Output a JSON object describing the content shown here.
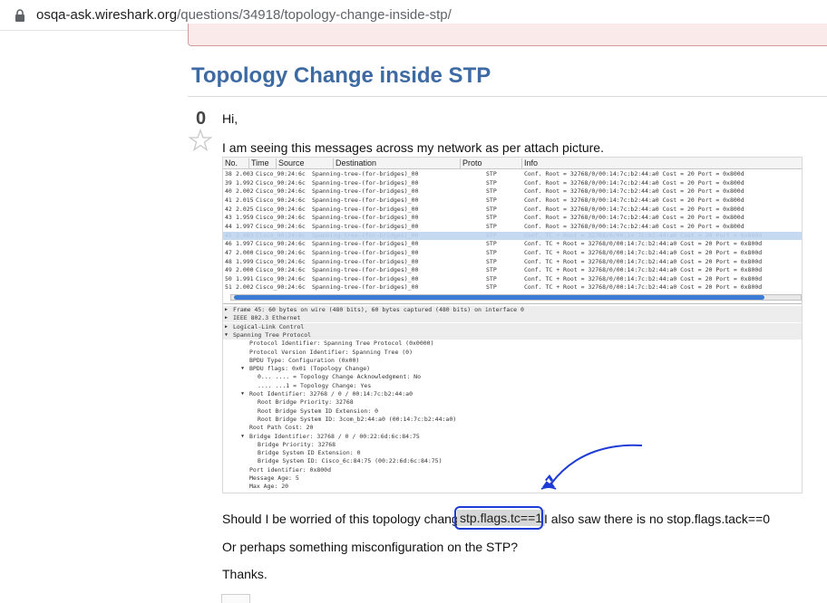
{
  "browser": {
    "url_host": "osqa-ask.wireshark.org",
    "url_path": "/questions/34918/topology-change-inside-stp/"
  },
  "question": {
    "title": "Topology Change inside STP",
    "votes": "0"
  },
  "body": {
    "greeting": "Hi,",
    "intro": "I am seeing this messages across my network as per attach picture.",
    "worry_prefix": "Should I be worried of this topology changes",
    "filter_code": "stp.flags.tc==1",
    "worry_suffix": "I also saw there is no stop.flags.tack==0",
    "misconfig": "Or perhaps something misconfiguration on the STP?",
    "thanks": "Thanks."
  },
  "wireshark": {
    "columns": [
      "No.",
      "Time",
      "Source",
      "Destination",
      "Proto",
      "Info"
    ],
    "rows": [
      {
        "no": "38",
        "time": "2.003",
        "src": "Cisco_90:24:6c",
        "dst": "Spanning-tree-(for-bridges)_00",
        "proto": "STP",
        "info": "Conf. Root = 32768/0/00:14:7c:b2:44:a0   Cost = 20   Port = 0x800d"
      },
      {
        "no": "39",
        "time": "1.992",
        "src": "Cisco_90:24:6c",
        "dst": "Spanning-tree-(for-bridges)_00",
        "proto": "STP",
        "info": "Conf. Root = 32768/0/00:14:7c:b2:44:a0   Cost = 20   Port = 0x800d"
      },
      {
        "no": "40",
        "time": "2.002",
        "src": "Cisco_90:24:6c",
        "dst": "Spanning-tree-(for-bridges)_00",
        "proto": "STP",
        "info": "Conf. Root = 32768/0/00:14:7c:b2:44:a0   Cost = 20   Port = 0x800d"
      },
      {
        "no": "41",
        "time": "2.015",
        "src": "Cisco_90:24:6c",
        "dst": "Spanning-tree-(for-bridges)_00",
        "proto": "STP",
        "info": "Conf. Root = 32768/0/00:14:7c:b2:44:a0   Cost = 20   Port = 0x800d"
      },
      {
        "no": "42",
        "time": "2.025",
        "src": "Cisco_90:24:6c",
        "dst": "Spanning-tree-(for-bridges)_00",
        "proto": "STP",
        "info": "Conf. Root = 32768/0/00:14:7c:b2:44:a0   Cost = 20   Port = 0x800d"
      },
      {
        "no": "43",
        "time": "1.959",
        "src": "Cisco_90:24:6c",
        "dst": "Spanning-tree-(for-bridges)_00",
        "proto": "STP",
        "info": "Conf. Root = 32768/0/00:14:7c:b2:44:a0   Cost = 20   Port = 0x800d"
      },
      {
        "no": "44",
        "time": "1.997",
        "src": "Cisco_90:24:6c",
        "dst": "Spanning-tree-(for-bridges)_00",
        "proto": "STP",
        "info": "Conf. Root = 32768/0/00:14:7c:b2:44:a0   Cost = 20   Port = 0x800d"
      },
      {
        "no": "45",
        "time": "2.003",
        "src": "Cisco_90:24:6c",
        "dst": "Spanning-tree-(for-bridges)_00",
        "proto": "STP",
        "info": "Conf. TC + Root = 32768/0/00:14:7c:b2:44:a0   Cost = 20   Port = 0x800d"
      },
      {
        "no": "46",
        "time": "1.997",
        "src": "Cisco_90:24:6c",
        "dst": "Spanning-tree-(for-bridges)_00",
        "proto": "STP",
        "info": "Conf. TC + Root = 32768/0/00:14:7c:b2:44:a0   Cost = 20   Port = 0x800d"
      },
      {
        "no": "47",
        "time": "2.000",
        "src": "Cisco_90:24:6c",
        "dst": "Spanning-tree-(for-bridges)_00",
        "proto": "STP",
        "info": "Conf. TC + Root = 32768/0/00:14:7c:b2:44:a0   Cost = 20   Port = 0x800d"
      },
      {
        "no": "48",
        "time": "1.999",
        "src": "Cisco_90:24:6c",
        "dst": "Spanning-tree-(for-bridges)_00",
        "proto": "STP",
        "info": "Conf. TC + Root = 32768/0/00:14:7c:b2:44:a0   Cost = 20   Port = 0x800d"
      },
      {
        "no": "49",
        "time": "2.000",
        "src": "Cisco_90:24:6c",
        "dst": "Spanning-tree-(for-bridges)_00",
        "proto": "STP",
        "info": "Conf. TC + Root = 32768/0/00:14:7c:b2:44:a0   Cost = 20   Port = 0x800d"
      },
      {
        "no": "50",
        "time": "1.991",
        "src": "Cisco_90:24:6c",
        "dst": "Spanning-tree-(for-bridges)_00",
        "proto": "STP",
        "info": "Conf. TC + Root = 32768/0/00:14:7c:b2:44:a0   Cost = 20   Port = 0x800d"
      },
      {
        "no": "51",
        "time": "2.002",
        "src": "Cisco_90:24:6c",
        "dst": "Spanning-tree-(for-bridges)_00",
        "proto": "STP",
        "info": "Conf. TC + Root = 32768/0/00:14:7c:b2:44:a0   Cost = 20   Port = 0x800d"
      }
    ],
    "details": [
      "Frame 45: 60 bytes on wire (480 bits), 60 bytes captured (480 bits) on interface 0",
      "IEEE 802.3 Ethernet",
      "Logical-Link Control",
      "Spanning Tree Protocol",
      "Protocol Identifier: Spanning Tree Protocol (0x0000)",
      "Protocol Version Identifier: Spanning Tree (0)",
      "BPDU Type: Configuration (0x00)",
      "BPDU flags: 0x01 (Topology Change)",
      "0... .... = Topology Change Acknowledgment: No",
      ".... ...1 = Topology Change: Yes",
      "Root Identifier: 32768 / 0 / 00:14:7c:b2:44:a0",
      "Root Bridge Priority: 32768",
      "Root Bridge System ID Extension: 0",
      "Root Bridge System ID: 3com_b2:44:a0 (00:14:7c:b2:44:a0)",
      "Root Path Cost: 20",
      "Bridge Identifier: 32768 / 0 / 00:22:6d:6c:84:75",
      "Bridge Priority: 32768",
      "Bridge System ID Extension: 0",
      "Bridge System ID: Cisco_6c:84:75 (00:22:6d:6c:84:75)",
      "Port identifier: 0x800d",
      "Message Age: 5",
      "Max Age: 20"
    ]
  }
}
